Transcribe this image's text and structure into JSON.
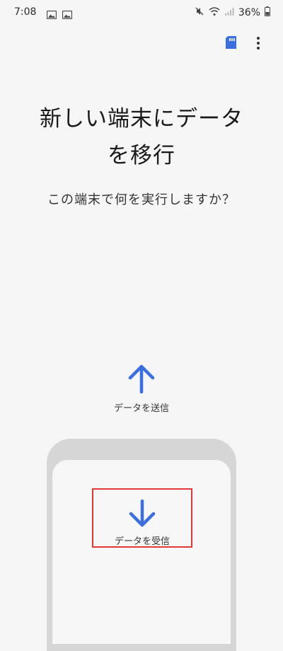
{
  "status_bar": {
    "time": "7:08",
    "battery": "36%"
  },
  "header": {
    "title_line1": "新しい端末にデータ",
    "title_line2": "を移行",
    "subtitle": "この端末で何を実行しますか？"
  },
  "options": {
    "send_label": "データを送信",
    "receive_label": "データを受信"
  },
  "colors": {
    "accent": "#3b6fe0",
    "highlight": "#e53935"
  }
}
